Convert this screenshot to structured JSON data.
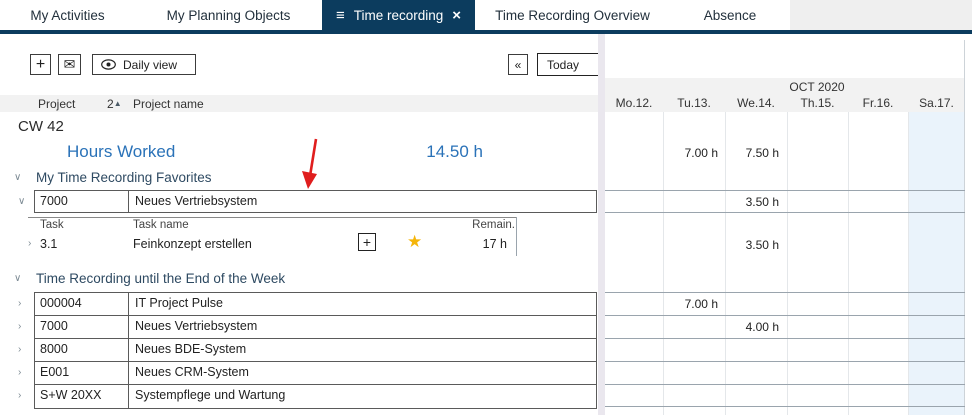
{
  "tabs": {
    "items": [
      {
        "label": "My Activities"
      },
      {
        "label": "My Planning Objects"
      },
      {
        "label": "Time recording"
      },
      {
        "label": "Time Recording Overview"
      },
      {
        "label": "Absence"
      }
    ]
  },
  "icons": {
    "menu": "≡",
    "close": "×",
    "expand": "∨",
    "collapse": "›",
    "add": "+",
    "envelope": "✉",
    "back": "«",
    "sort_asc": "▲",
    "star": "★"
  },
  "toolbar": {
    "daily_view": "Daily view",
    "today": "Today"
  },
  "columns": {
    "project": "Project",
    "sort_indicator": "2",
    "project_name": "Project name",
    "task": "Task",
    "task_name": "Task name",
    "remain": "Remain."
  },
  "calendar": {
    "month": "OCT 2020",
    "days": [
      "Mo.12.",
      "Tu.13.",
      "We.14.",
      "Th.15.",
      "Fr.16.",
      "Sa.17."
    ]
  },
  "week": {
    "label": "CW 42",
    "hours_worked_label": "Hours Worked",
    "hours_worked_total": "14.50 h",
    "hours_tu": "7.00 h",
    "hours_we": "7.50 h"
  },
  "favorites": {
    "title": "My Time Recording Favorites",
    "project": {
      "code": "7000",
      "name": "Neues Vertriebsystem",
      "we": "3.50 h"
    },
    "task": {
      "id": "3.1",
      "name": "Feinkonzept erstellen",
      "remain": "17 h",
      "we": "3.50 h"
    }
  },
  "week_recording": {
    "title": "Time Recording until the End of the Week",
    "rows": [
      {
        "code": "000004",
        "name": "IT Project Pulse",
        "tu": "7.00 h"
      },
      {
        "code": "7000",
        "name": "Neues Vertriebsystem",
        "we": "4.00 h"
      },
      {
        "code": "8000",
        "name": "Neues BDE-System"
      },
      {
        "code": "E001",
        "name": "Neues CRM-System"
      },
      {
        "code": "S+W 20XX",
        "name": "Systempflege und Wartung"
      }
    ]
  },
  "colors": {
    "accent_navy": "#0c3c5e",
    "link_blue": "#2a72b8",
    "weekend_bg": "#eaf3fb",
    "star_gold": "#f5b50a",
    "arrow_red": "#e01e1e",
    "header_bg": "#f2f2f2"
  }
}
